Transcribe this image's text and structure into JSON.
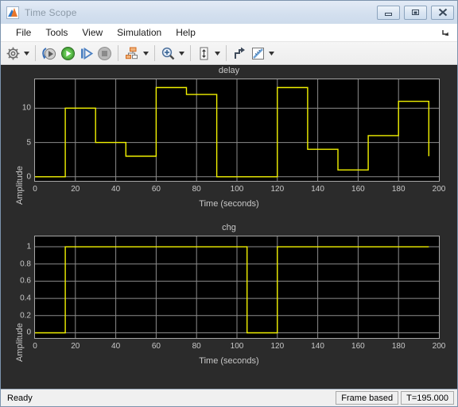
{
  "window": {
    "title": "Time Scope",
    "icon": "matlab-icon",
    "buttons": [
      {
        "name": "minimize-button",
        "glyph": "minimize"
      },
      {
        "name": "restore-button",
        "glyph": "restore"
      },
      {
        "name": "close-button",
        "glyph": "close"
      }
    ]
  },
  "menubar": {
    "items": [
      {
        "label": "File"
      },
      {
        "label": "Tools"
      },
      {
        "label": "View"
      },
      {
        "label": "Simulation"
      },
      {
        "label": "Help"
      }
    ],
    "undock_icon": "undock-arrow-icon"
  },
  "toolbar": {
    "groups": [
      [
        {
          "name": "configuration-properties-button",
          "icon": "gear-icon",
          "dropdown": true
        }
      ],
      [
        {
          "name": "run-from-start-button",
          "icon": "rewind-play-icon",
          "dropdown": false
        },
        {
          "name": "run-button",
          "icon": "play-icon",
          "dropdown": false
        },
        {
          "name": "step-forward-button",
          "icon": "step-forward-icon",
          "dropdown": false
        },
        {
          "name": "stop-button",
          "icon": "stop-icon",
          "dropdown": false
        }
      ],
      [
        {
          "name": "signal-selection-button",
          "icon": "signal-hierarchy-icon",
          "dropdown": true
        }
      ],
      [
        {
          "name": "zoom-button",
          "icon": "zoom-in-icon",
          "dropdown": true
        }
      ],
      [
        {
          "name": "autoscale-button",
          "icon": "autoscale-icon",
          "dropdown": true
        }
      ],
      [
        {
          "name": "scale-axes-limits-button",
          "icon": "axes-scale-icon",
          "dropdown": false
        },
        {
          "name": "measurements-button",
          "icon": "ruler-icon",
          "dropdown": true
        }
      ]
    ]
  },
  "statusbar": {
    "status": "Ready",
    "frame_mode": "Frame based",
    "time": "T=195.000"
  },
  "colors": {
    "trace": "#f2f200",
    "plot_background": "#000000",
    "scope_background": "#2b2b2b",
    "grid": "#8c8c8c",
    "axis_text": "#c8c8c8"
  },
  "chart_data": [
    {
      "type": "line",
      "title": "delay",
      "xlabel": "Time (seconds)",
      "ylabel": "Amplitude",
      "xlim": [
        0,
        200
      ],
      "ylim": [
        -0.6,
        14.2
      ],
      "xticks": [
        0,
        20,
        40,
        60,
        80,
        100,
        120,
        140,
        160,
        180,
        200
      ],
      "yticks": [
        0,
        5,
        10
      ],
      "grid": true,
      "legend": "none",
      "style": "stairs",
      "series": [
        {
          "name": "delay",
          "color": "#f2f200",
          "x": [
            0,
            15,
            30,
            45,
            60,
            75,
            90,
            120,
            135,
            150,
            165,
            180,
            195
          ],
          "values": [
            0,
            10,
            5,
            3,
            13,
            12,
            0,
            13,
            4,
            1,
            6,
            11,
            3
          ]
        }
      ]
    },
    {
      "type": "line",
      "title": "chg",
      "xlabel": "Time (seconds)",
      "ylabel": "Amplitude",
      "xlim": [
        0,
        200
      ],
      "ylim": [
        -0.06,
        1.12
      ],
      "xticks": [
        0,
        20,
        40,
        60,
        80,
        100,
        120,
        140,
        160,
        180,
        200
      ],
      "yticks": [
        0,
        0.2,
        0.4,
        0.6,
        0.8,
        1
      ],
      "ytick_labels": [
        "0",
        "0.2",
        "0.4",
        "0.6",
        "0.8",
        "1"
      ],
      "grid": true,
      "legend": "none",
      "style": "stairs",
      "series": [
        {
          "name": "chg",
          "color": "#f2f200",
          "x": [
            0,
            15,
            105,
            120,
            195
          ],
          "values": [
            0,
            1,
            0,
            1,
            1
          ]
        }
      ]
    }
  ]
}
